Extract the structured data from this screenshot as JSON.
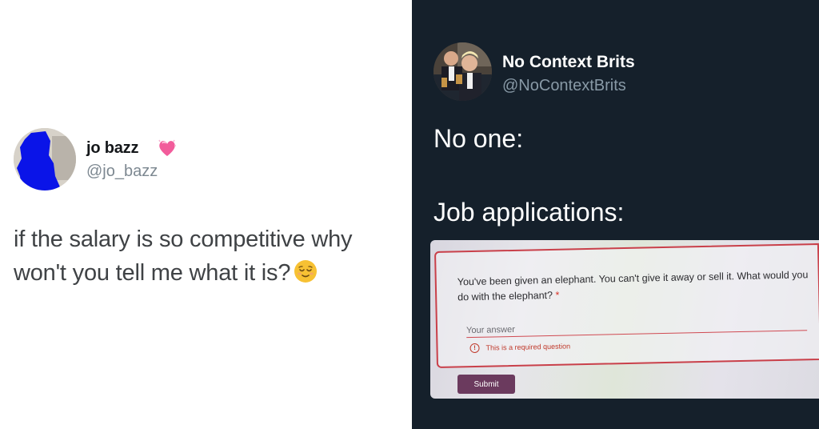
{
  "left_tweet": {
    "display_name": "jo bazz",
    "heart_emoji": "sparkling-heart",
    "handle": "@jo_bazz",
    "body_line1": "if the salary is so competitive why",
    "body_line2": "won't you tell me what it is?",
    "emoji": "relieved-face"
  },
  "right_tweet": {
    "display_name": "No Context Brits",
    "handle": "@NoContextBrits",
    "line1": "No one:",
    "line2": "Job applications:",
    "form": {
      "question": "You've been given an elephant. You can't give it away or sell it. What would you do with the elephant?",
      "required_marker": "*",
      "answer_placeholder": "Your answer",
      "error_icon": "!",
      "error_text": "This is a required question",
      "submit_label": "Submit"
    }
  },
  "colors": {
    "left_background": "#ffffff",
    "right_background": "#15202b",
    "form_border": "#c9404a",
    "submit_background": "#6b3a5e",
    "error_color": "#c0392b"
  }
}
